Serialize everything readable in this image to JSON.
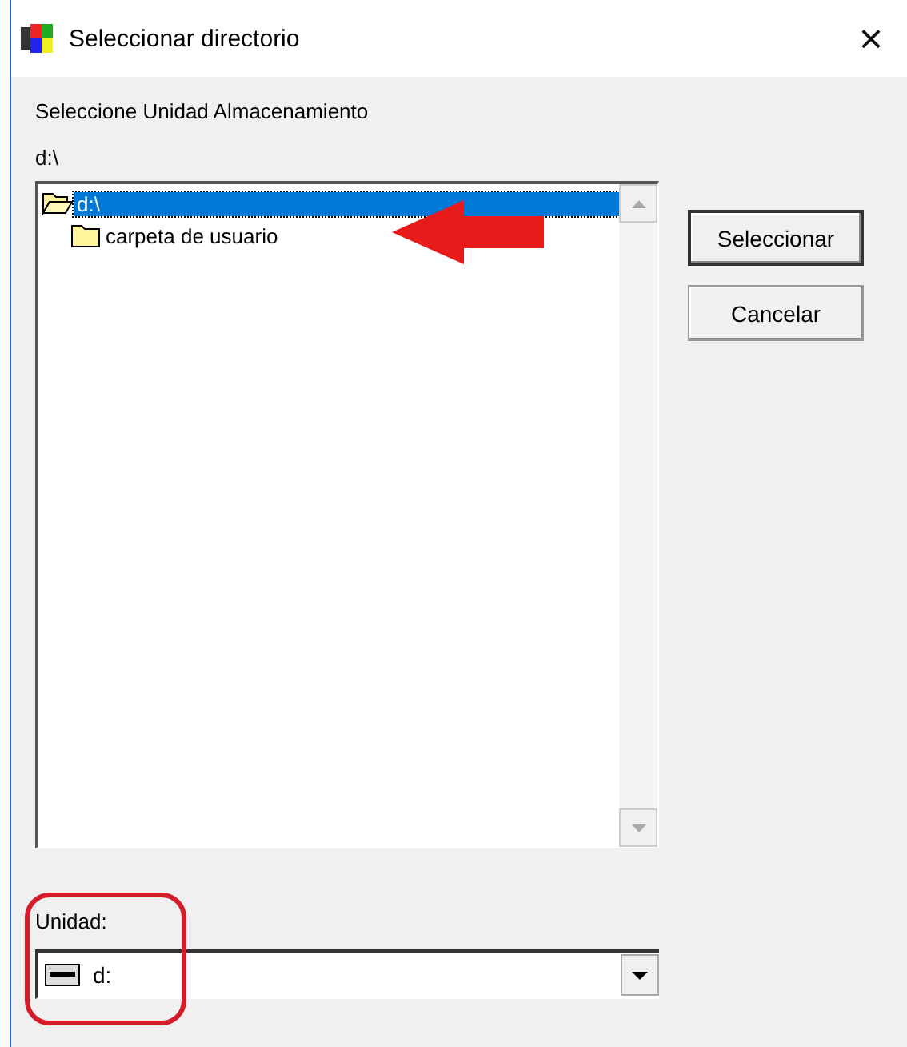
{
  "window": {
    "title": "Seleccionar directorio",
    "close": "×"
  },
  "prompt": "Seleccione Unidad Almacenamiento",
  "current_path": "d:\\",
  "tree": [
    {
      "label": "d:\\",
      "expanded": true,
      "selected": true,
      "children": [
        {
          "label": "carpeta de usuario",
          "expanded": false,
          "selected": false
        }
      ]
    }
  ],
  "buttons": [
    {
      "label": "Seleccionar",
      "default": true
    },
    {
      "label": "Cancelar",
      "default": false
    }
  ],
  "drive": {
    "label": "Unidad:",
    "value": "d:"
  }
}
